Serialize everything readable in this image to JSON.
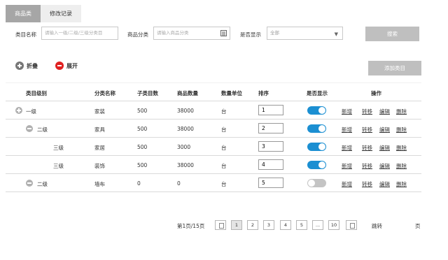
{
  "tabs": [
    {
      "label": "商品类",
      "active": true
    },
    {
      "label": "修改记录",
      "active": false
    }
  ],
  "filters": {
    "category_name_label": "类目名称",
    "category_name_placeholder": "请输入一级/二级/三级分类目",
    "product_category_label": "商品分类",
    "product_category_placeholder": "请输入商品分类",
    "display_label": "是否显示",
    "display_value": "全部",
    "search_button": "搜索"
  },
  "toolbar": {
    "collapse_label": "折叠",
    "expand_label": "展开",
    "add_category_button": "添加类目"
  },
  "table": {
    "headers": [
      "类目级别",
      "分类名称",
      "子类目数",
      "商品数量",
      "数量单位",
      "排序",
      "是否显示",
      "操作"
    ],
    "rows": [
      {
        "level": "一级",
        "name": "家装",
        "children": "500",
        "count": "38000",
        "unit": "台",
        "sort": "1",
        "visible": true,
        "ops": [
          "新增",
          "转移",
          "编辑",
          "删除"
        ]
      },
      {
        "level": "二级",
        "name": "家具",
        "children": "500",
        "count": "38000",
        "unit": "台",
        "sort": "2",
        "visible": true,
        "ops": [
          "新增",
          "转移",
          "编辑",
          "删除"
        ]
      },
      {
        "level": "三级",
        "name": "家居",
        "children": "500",
        "count": "3000",
        "unit": "台",
        "sort": "3",
        "visible": true,
        "ops": [
          "新增",
          "转移",
          "编辑",
          "删除"
        ]
      },
      {
        "level": "三级",
        "name": "装饰",
        "children": "500",
        "count": "38000",
        "unit": "台",
        "sort": "4",
        "visible": true,
        "ops": [
          "新增",
          "转移",
          "编辑",
          "删除"
        ]
      },
      {
        "level": "二级",
        "name": "墙布",
        "children": "0",
        "count": "0",
        "unit": "台",
        "sort": "5",
        "visible": false,
        "ops": [
          "新增",
          "转移",
          "编辑",
          "删除"
        ]
      }
    ]
  },
  "pagination": {
    "info": "第1页/15页",
    "pages": [
      "1",
      "2",
      "3",
      "4",
      "5",
      "...",
      "10"
    ],
    "current": "1",
    "jump_label": "跳转",
    "page_unit": "页"
  },
  "colors": {
    "toggle_on": "#1b8fd2",
    "toggle_off": "#c4c4c4",
    "expand_icon": "#e02020",
    "disabled_button": "#bfbfbf"
  }
}
